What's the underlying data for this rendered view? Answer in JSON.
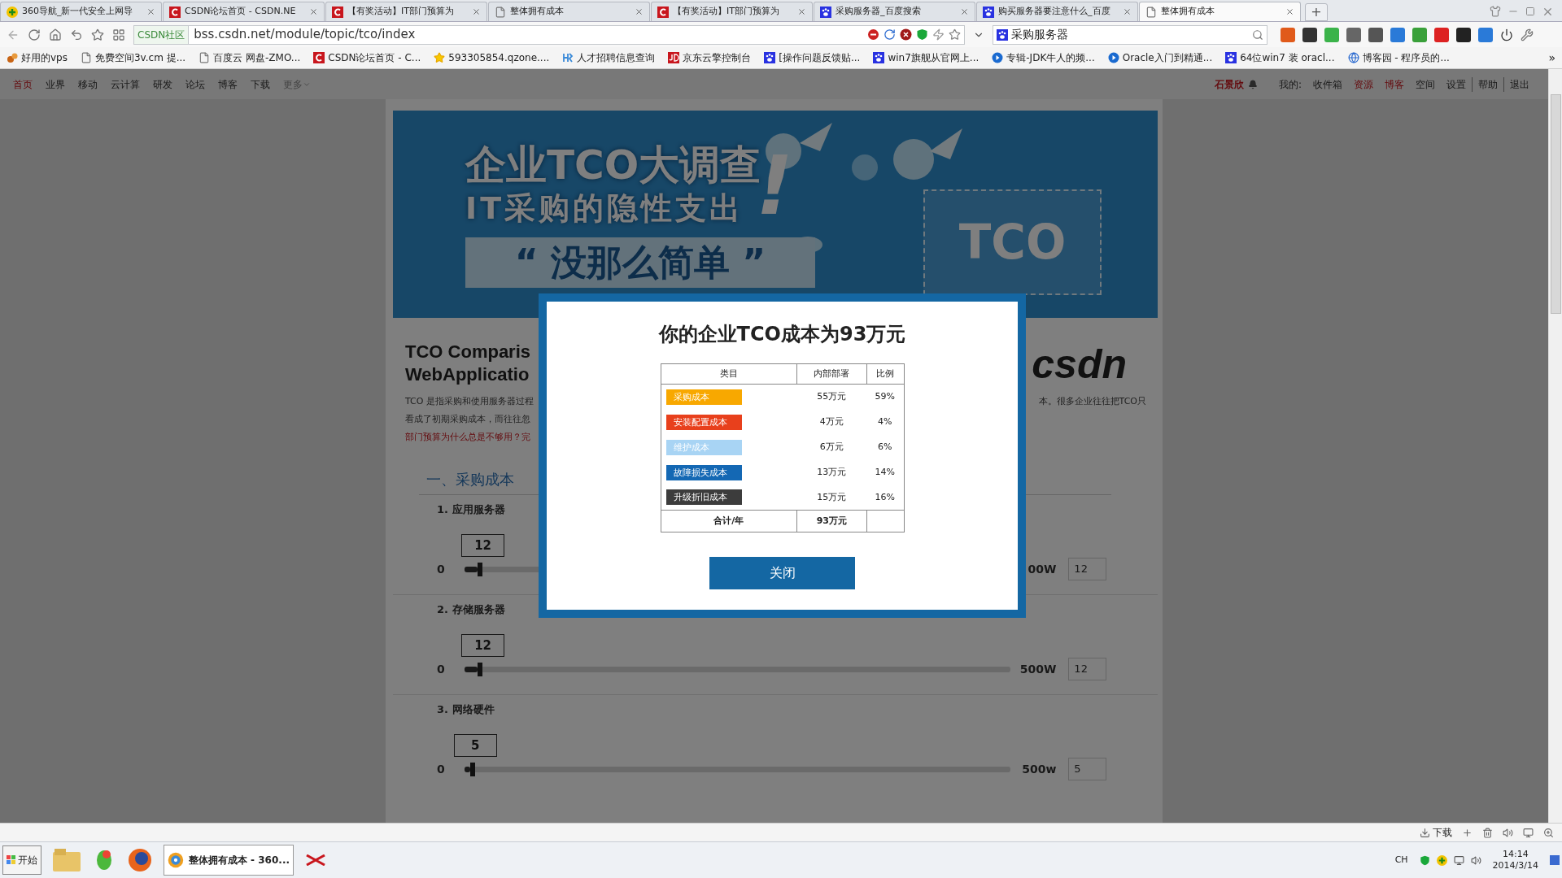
{
  "browser": {
    "tabs": [
      {
        "title": "360导航_新一代安全上网导",
        "selected": false
      },
      {
        "title": "CSDN论坛首页 - CSDN.NE",
        "selected": false
      },
      {
        "title": "【有奖活动】IT部门预算为",
        "selected": false
      },
      {
        "title": "整体拥有成本",
        "selected": false
      },
      {
        "title": "【有奖活动】IT部门预算为",
        "selected": false
      },
      {
        "title": "采购服务器_百度搜索",
        "selected": false
      },
      {
        "title": "购买服务器要注意什么_百度",
        "selected": false
      },
      {
        "title": "整体拥有成本",
        "selected": true
      }
    ],
    "new_tab": "+",
    "url_badge": "CSDN社区",
    "url": "bss.csdn.net/module/topic/tco/index",
    "search_value": "采购服务器",
    "bookmarks": [
      "好用的vps",
      "免费空间3v.cm 提...",
      "百度云 网盘-ZMO...",
      "CSDN论坛首页 - C...",
      "593305854.qzone....",
      "人才招聘信息查询",
      "京东云擎控制台",
      "[操作问题反馈贴...",
      "win7旗舰从官网上...",
      "专辑-JDK牛人的频...",
      "Oracle入门到精通...",
      "64位win7 装 oracl...",
      "博客园 - 程序员的..."
    ],
    "bookmarks_more": "»"
  },
  "nav": {
    "items": [
      {
        "label": "首页",
        "selected": true
      },
      {
        "label": "业界",
        "selected": false
      },
      {
        "label": "移动",
        "selected": false
      },
      {
        "label": "云计算",
        "selected": false
      },
      {
        "label": "研发",
        "selected": false
      },
      {
        "label": "论坛",
        "selected": false
      },
      {
        "label": "博客",
        "selected": false
      },
      {
        "label": "下载",
        "selected": false
      }
    ],
    "more": "更多",
    "user": "石景欣",
    "mine_label": "我的:",
    "links": [
      {
        "label": "收件箱",
        "highlighted": false
      },
      {
        "label": "资源",
        "highlighted": true
      },
      {
        "label": "博客",
        "highlighted": true
      },
      {
        "label": "空间",
        "highlighted": false
      }
    ],
    "tools": [
      "设置",
      "帮助",
      "退出"
    ]
  },
  "banner": {
    "headline": "企业TCO大调查",
    "exclaim": "!",
    "subline": "IT采购的隐性支出",
    "slogan": "“ 没那么简单 ”",
    "card": "TCO"
  },
  "page": {
    "title_lines": [
      "TCO Comparis",
      "WebApplicatio"
    ],
    "logo": "csdn",
    "intro": [
      {
        "left": "TCO 是指采购和使用服务器过程",
        "right": "本。很多企业往往把TCO只",
        "highlighted": false
      },
      {
        "left": "看成了初期采购成本，而往往忽",
        "highlighted": false
      },
      {
        "left": "部门预算为什么总是不够用？完",
        "highlighted": true
      }
    ],
    "section": "一、采购成本",
    "sliders": [
      {
        "label": "1. 应用服务器",
        "bubble": "12",
        "min": "0",
        "max": "00W",
        "level": 0.024,
        "input": "12"
      },
      {
        "label": "2. 存储服务器",
        "bubble": "12",
        "min": "0",
        "max": "500W",
        "level": 0.024,
        "input": "12"
      },
      {
        "label": "3. 网络硬件",
        "bubble": "5",
        "min": "0",
        "max": "500w",
        "level": 0.01,
        "input": "5"
      }
    ]
  },
  "modal": {
    "title": "你的企业TCO成本为93万元",
    "columns": [
      "类目",
      "内部部署",
      "比例"
    ],
    "rows": [
      {
        "label": "采购成本",
        "color": "#f8a800",
        "value": "55万元",
        "share": "59%"
      },
      {
        "label": "安装配置成本",
        "color": "#e8401c",
        "value": "4万元",
        "share": "4%"
      },
      {
        "label": "维护成本",
        "color": "#a8d4f4",
        "value": "6万元",
        "share": "6%"
      },
      {
        "label": "故障损失成本",
        "color": "#1468b4",
        "value": "13万元",
        "share": "14%"
      },
      {
        "label": "升级折旧成本",
        "color": "#3c3c3c",
        "value": "15万元",
        "share": "16%"
      }
    ],
    "total": {
      "label": "合计/年",
      "value": "93万元"
    },
    "button": "关闭"
  },
  "status_bar": {
    "downloads": "下载"
  },
  "taskbar": {
    "start": "开始",
    "app": "整体拥有成本 - 360...",
    "lang": "CH",
    "time": "14:14",
    "date": "2014/3/14"
  }
}
